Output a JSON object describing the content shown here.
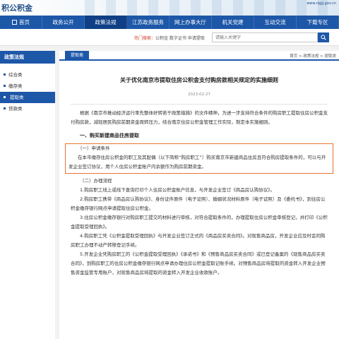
{
  "banner": {
    "logo_text": "积公积金",
    "url": "www.njgjj.gov.cn"
  },
  "nav": {
    "items": [
      "首页",
      "政务公开",
      "政策法规",
      "江苏政务服务",
      "网上办事大厅",
      "机关党建",
      "互动交流",
      "下载专区"
    ]
  },
  "hotbar": {
    "label": "热门搜索：",
    "words": "公积金  数字证书  申请提取",
    "search_placeholder": "请输入关键字"
  },
  "sidebar": {
    "title": "政策法规",
    "items": [
      "综合类",
      "缴存类",
      "提取类",
      "贷款类"
    ]
  },
  "crumb": {
    "tab": "提取类",
    "path": "首页 > 政策法规 > 提取类"
  },
  "article": {
    "title": "关于优化南京市提取住房公积金支付购房款相关规定的实施细则",
    "date": "2023-02-27",
    "intro": "根据《南京市推动经济运行率先整体好转若干政策措施》的文件精神，为进一步支持符合条件的购房职工提取住房公积金支付购房款，减轻居民购房前期资金周转压力，结合南京住房公积金管理工作实际，制定本实施细则。",
    "section1": "一、购买新建商品住房提取",
    "cond_head": "（一）申请条件",
    "cond_text": "在本市缴存住房公积金的职工及其配偶（以下简称“购房职工”）购买南京市新建商品住房且符合购房提取条件的，可以与开发企业签订协议，用个人住房公积金账户内余额作为购房前期资金。",
    "proc_head": "（二）办理流程",
    "steps": [
      "1.购房职工线上或线下查询打印个人住房公积金账户信息，与开发企业签订《商品房认购协议》。",
      "2.购房职工携带《商品房认购协议》、身份证件原件（电子证照）、婚姻状况材料原件（电子证照）及《委托书》，到住房公积金缴存银行网点申请提取住房公积金。",
      "3.住房公积金缴存银行对购房职工提交的材料进行审核，对符合提取条件的，办理提取住房公积金审核登记，并打印《公积金提取受理回执》。",
      "4.购房职工凭《公积金提取受理回执》与开发企业签订正式的《商品房买卖合同》。对现售商品房，开发企业应及时会同购房职工办理不动产转移登记手续。",
      "5.开发企业凭购房职工的《公积金提取受理回执》《承诺书》和《预售商品房买卖合同》或已登记备案的《现售商品房买卖合同》，到购房职工的住房公积金缴存银行网点申请办理住房公积金提取记账手续。对预售商品房将提取的资金转入开发企业预售资金监管专用账户，对现售商品房将提取的资金转入开发企业收款账户。"
    ]
  }
}
